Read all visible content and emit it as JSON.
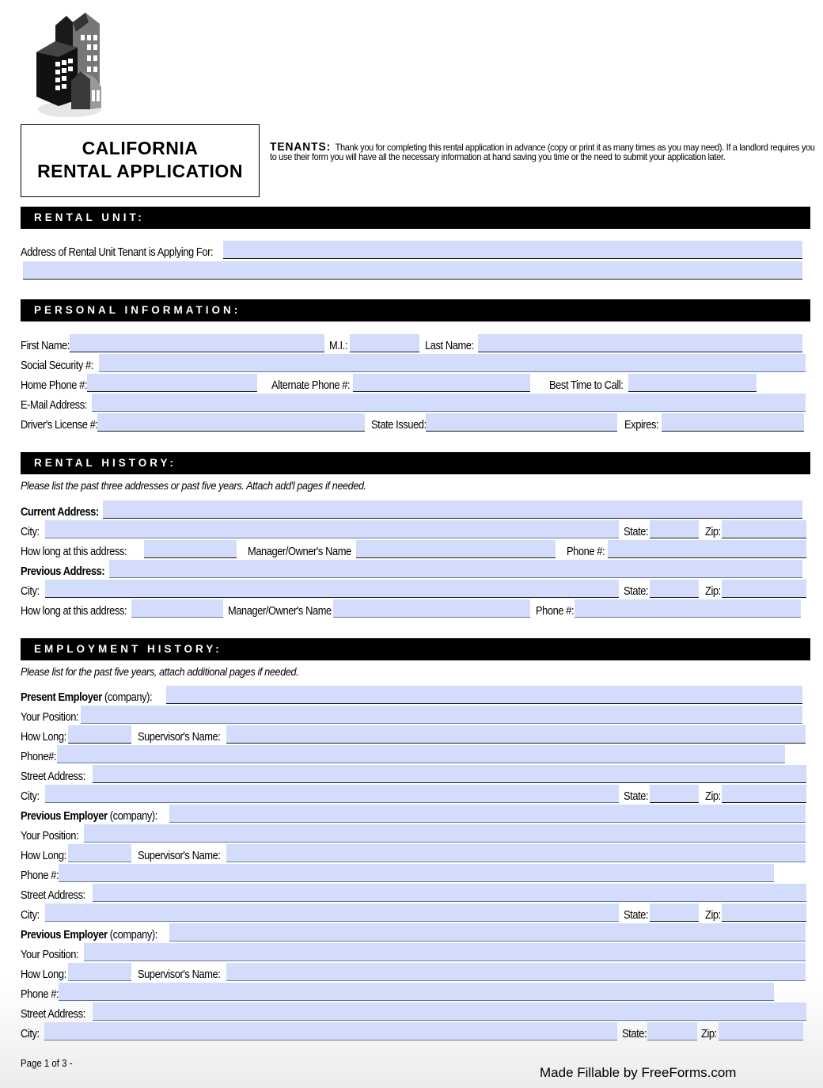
{
  "header": {
    "title_line1": "CALIFORNIA",
    "title_line2": "RENTAL APPLICATION",
    "tenants_label": "TENANTS:",
    "tenants_text": "Thank you for completing this rental application in advance (copy or print it as many times as you may need). If a landlord requires you to use their form you will have all the necessary information at hand saving you time or the need to submit your application later."
  },
  "sections": {
    "rental_unit": "RENTAL UNIT:",
    "personal_info": "PERSONAL INFORMATION:",
    "rental_history": "RENTAL HISTORY:",
    "employment_history": "EMPLOYMENT HISTORY:"
  },
  "notes": {
    "rental_history": "Please list the past three addresses or past five years. Attach add'l pages if needed.",
    "employment_history": "Please list for the past five years, attach additional pages if needed."
  },
  "labels": {
    "rental_unit_address": "Address of Rental Unit Tenant is Applying For:",
    "first_name": "First Name:",
    "mi": "M.I.:",
    "last_name": "Last Name:",
    "ssn": "Social  Security #:",
    "home_phone": "Home Phone #:",
    "alt_phone": "Alternate Phone #:",
    "best_time": "Best Time to Call:",
    "email": "E-Mail  Address:",
    "drivers_license": "Driver's License #:",
    "state_issued": "State Issued:",
    "expires": "Expires:",
    "current_address": "Current Address:",
    "previous_address": "Previous Address:",
    "city": "City:",
    "state": "State:",
    "zip": "Zip:",
    "how_long_address_1": "How  long  at  this  address:",
    "manager_name_1": "Manager/Owner's  Name",
    "phone_1": "Phone  #:",
    "how_long_address_2": "How long at this address:",
    "manager_name_2": "Manager/Owner's Name",
    "phone_2": "Phone #:",
    "present_employer": "Present Employer",
    "previous_employer": "Previous Employer",
    "company": "(company):",
    "your_position_1": "Your Position:",
    "your_position_2": "Your  Position:",
    "how_long": "How Long:",
    "supervisor": "Supervisor's Name:",
    "phone_hash": "Phone#:",
    "phone_hash_sp": "Phone #:",
    "street_address": "Street  Address:"
  },
  "fields": {
    "value": ""
  },
  "footer": {
    "page": "Page 1 of 3 -",
    "brand": "Made Fillable by FreeForms.com"
  },
  "colors": {
    "field_fill": "#d4dcfc",
    "section_bar": "#000000"
  }
}
